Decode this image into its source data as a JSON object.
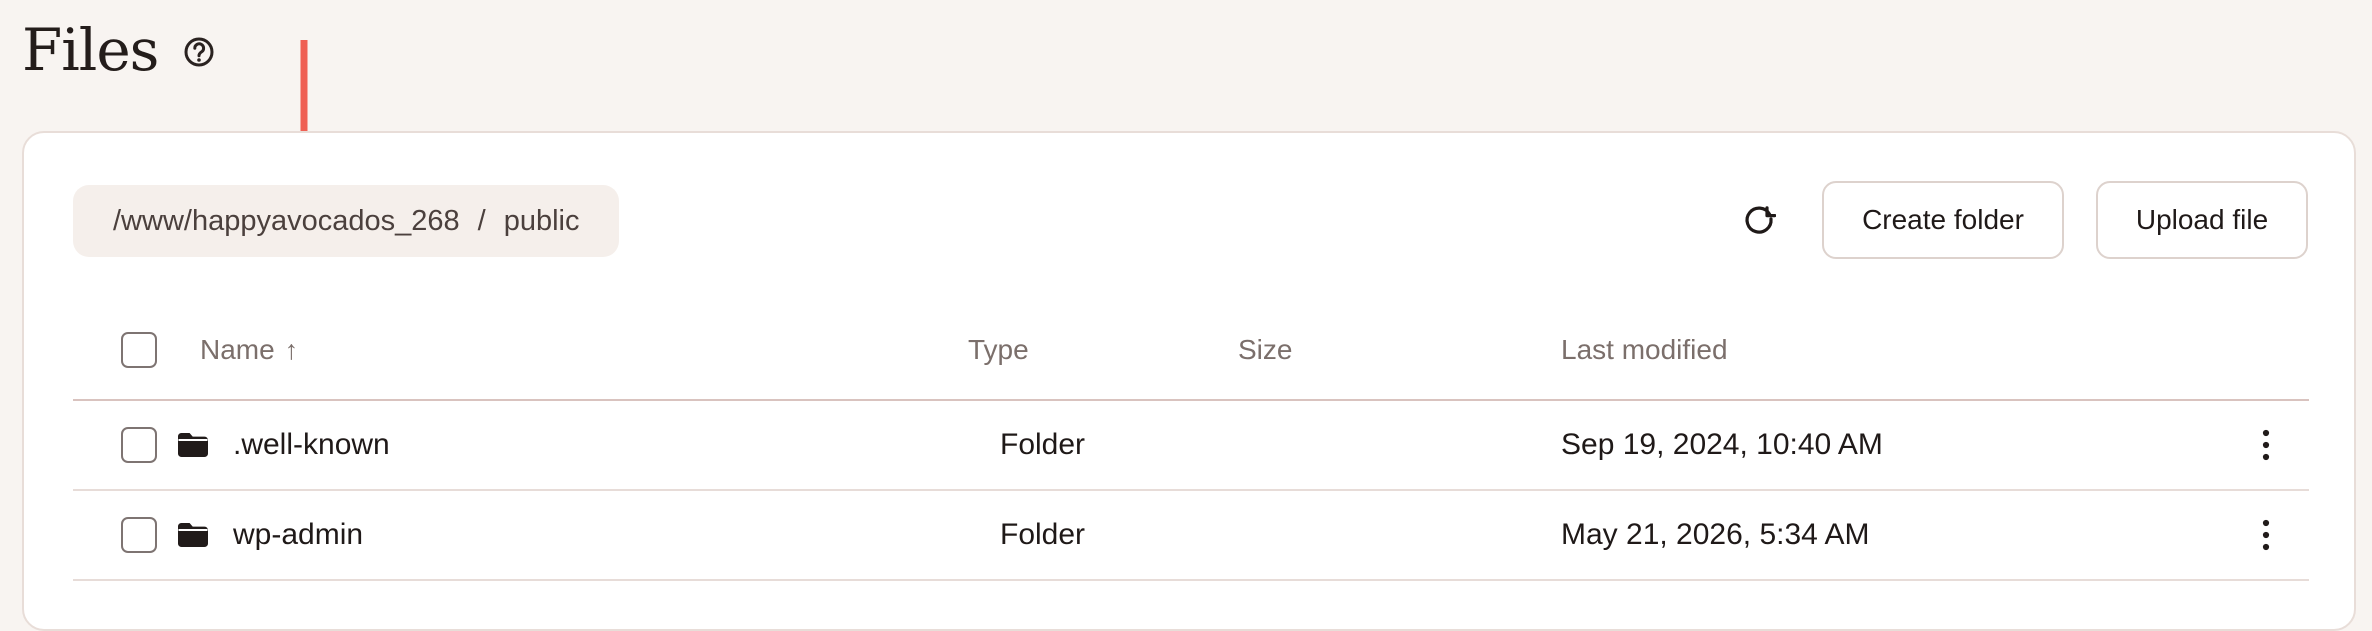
{
  "page": {
    "title": "Files",
    "help_icon": "help-circle-icon"
  },
  "annotation": {
    "icon": "down-arrow-annotation",
    "color": "#ef6054"
  },
  "path": {
    "segments": [
      {
        "label": "/www/happyavocados_268"
      },
      {
        "label": "public"
      }
    ],
    "separator": "/"
  },
  "toolbar": {
    "refresh_icon": "refresh-icon",
    "create_folder_label": "Create folder",
    "upload_file_label": "Upload file"
  },
  "table": {
    "headers": {
      "name": "Name",
      "sort_indicator": "↑",
      "type": "Type",
      "size": "Size",
      "last_modified": "Last modified"
    },
    "rows": [
      {
        "icon": "folder-icon",
        "name": ".well-known",
        "type": "Folder",
        "size": "",
        "last_modified": "Sep 19, 2024, 10:40 AM",
        "actions_icon": "more-vertical-icon"
      },
      {
        "icon": "folder-icon",
        "name": "wp-admin",
        "type": "Folder",
        "size": "",
        "last_modified": "May 21, 2026, 5:34 AM",
        "actions_icon": "more-vertical-icon"
      }
    ]
  },
  "colors": {
    "background": "#f8f4f1",
    "panel": "#ffffff",
    "accent_arrow": "#ef6054",
    "breadcrumb_bg": "#f5efeb"
  }
}
